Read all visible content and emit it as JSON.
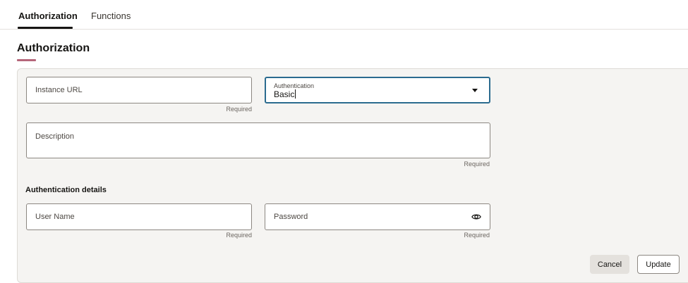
{
  "tabs": [
    {
      "label": "Authorization",
      "active": true
    },
    {
      "label": "Functions",
      "active": false
    }
  ],
  "section": {
    "title": "Authorization"
  },
  "form": {
    "instance_url": {
      "placeholder": "Instance URL",
      "hint": "Required"
    },
    "authentication": {
      "label": "Authentication",
      "value": "Basic"
    },
    "description": {
      "placeholder": "Description",
      "hint": "Required"
    },
    "auth_details": {
      "heading": "Authentication details"
    },
    "user_name": {
      "placeholder": "User Name",
      "hint": "Required"
    },
    "password": {
      "placeholder": "Password",
      "hint": "Required",
      "icon": "eye-icon"
    }
  },
  "actions": {
    "cancel_label": "Cancel",
    "update_label": "Update"
  },
  "colors": {
    "accent": "#b5667a",
    "focus": "#2b6b8f",
    "panel_bg": "#f5f4f2"
  }
}
